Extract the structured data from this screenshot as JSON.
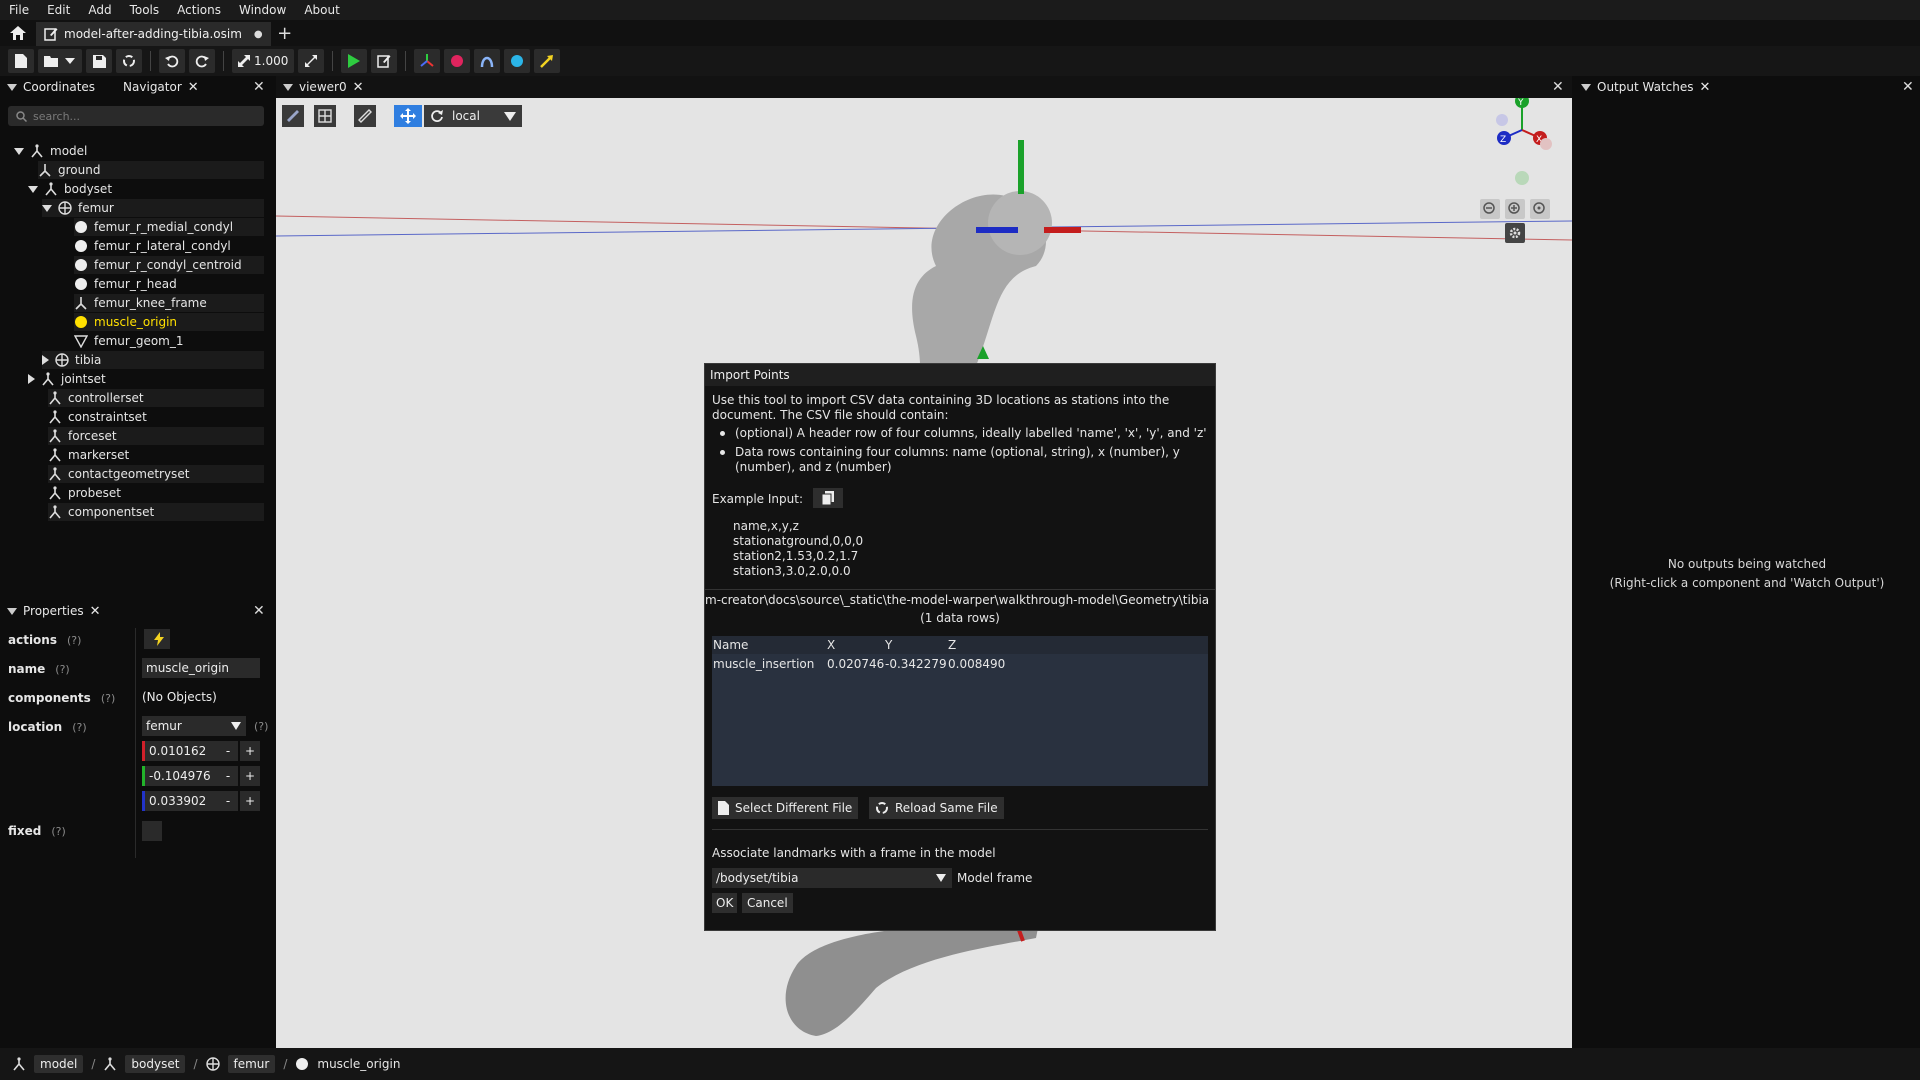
{
  "menu": [
    "File",
    "Edit",
    "Add",
    "Tools",
    "Actions",
    "Window",
    "About"
  ],
  "tab": {
    "title": "model-after-adding-tibia.osim",
    "modified_dot": "●",
    "add_label": "+"
  },
  "toolbar": {
    "scale_value": "1.000"
  },
  "left_panel": {
    "tab_coordinates": "Coordinates",
    "tab_navigator": "Navigator",
    "search_placeholder": "search...",
    "tree": {
      "model": "model",
      "ground": "ground",
      "bodyset": "bodyset",
      "femur": "femur",
      "femur_r_medial_condyl": "femur_r_medial_condyl",
      "femur_r_lateral_condyl": "femur_r_lateral_condyl",
      "femur_r_condyl_centroid": "femur_r_condyl_centroid",
      "femur_r_head": "femur_r_head",
      "femur_knee_frame": "femur_knee_frame",
      "muscle_origin": "muscle_origin",
      "femur_geom_1": "femur_geom_1",
      "tibia": "tibia",
      "jointset": "jointset",
      "controllerset": "controllerset",
      "constraintset": "constraintset",
      "forceset": "forceset",
      "markerset": "markerset",
      "contactgeometryset": "contactgeometryset",
      "probeset": "probeset",
      "componentset": "componentset"
    }
  },
  "properties": {
    "title": "Properties",
    "help": "(?)",
    "actions_label": "actions",
    "name_label": "name",
    "name_value": "muscle_origin",
    "components_label": "components",
    "components_value": "(No Objects)",
    "location_label": "location",
    "location_frame": "femur",
    "loc_x": "0.010162",
    "loc_y": "-0.104976",
    "loc_z": "0.033902",
    "minus": "-",
    "plus": "+",
    "fixed_label": "fixed"
  },
  "viewer": {
    "tab": "viewer0",
    "frame_mode": "local"
  },
  "output_watches": {
    "title": "Output Watches",
    "empty_line1": "No outputs being watched",
    "empty_line2": "(Right-click a component and 'Watch Output')"
  },
  "dialog": {
    "title": "Import Points",
    "intro_line1": "Use this tool to import CSV data containing 3D locations as stations into the",
    "intro_line2": "document. The CSV file should contain:",
    "bullet1": "(optional) A header row of four columns, ideally labelled 'name', 'x', 'y', and 'z'",
    "bullet2_line1": "Data rows containing four columns: name (optional, string), x (number), y",
    "bullet2_line2": "(number), and z (number)",
    "example_label": "Example Input:",
    "example_lines": [
      "name,x,y,z",
      "stationatground,0,0,0",
      "station2,1.53,0.2,1.7",
      "station3,3.0,2.0,0.0"
    ],
    "file_path": "m-creator\\docs\\source\\_static\\the-model-warper\\walkthrough-model\\Geometry\\tibia",
    "row_count": "(1 data rows)",
    "columns": [
      "Name",
      "X",
      "Y",
      "Z"
    ],
    "row": {
      "name": "muscle_insertion",
      "x": "0.020746",
      "y": "-0.342279",
      "z": "0.008490"
    },
    "select_file": "Select Different File",
    "reload_file": "Reload Same File",
    "associate_label": "Associate landmarks with a frame in the model",
    "frame_value": "/bodyset/tibia",
    "frame_hint": "Model frame",
    "ok": "OK",
    "cancel": "Cancel"
  },
  "breadcrumbs": [
    "model",
    "bodyset",
    "femur",
    "muscle_origin"
  ],
  "breadcrumb_sep": "/"
}
